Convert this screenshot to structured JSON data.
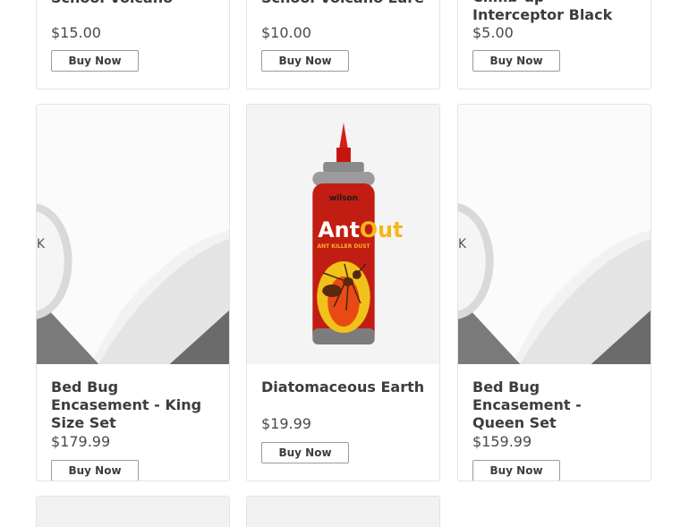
{
  "products": [
    {
      "title": "School Volcano",
      "price": "$15.00",
      "button": "Buy Now"
    },
    {
      "title": "School Volcano Lure",
      "price": "$10.00",
      "button": "Buy Now"
    },
    {
      "title": "Climb-up Interceptor Black",
      "price": "$5.00",
      "button": "Buy Now"
    },
    {
      "title": "Bed Bug Encasement - King Size Set",
      "price": "$179.99",
      "button": "Buy Now",
      "image": "mattress-encasement-image"
    },
    {
      "title": "Diatomaceous Earth",
      "price": "$19.99",
      "button": "Buy Now",
      "image": "antout-bottle-image"
    },
    {
      "title": "Bed Bug Encasement - Queen Set",
      "price": "$159.99",
      "button": "Buy Now",
      "image": "mattress-encasement-image"
    }
  ],
  "bottle": {
    "brand": "wilson",
    "name_a": "Ant",
    "name_b": "Out",
    "tagline": "ANT KILLER DUST"
  }
}
